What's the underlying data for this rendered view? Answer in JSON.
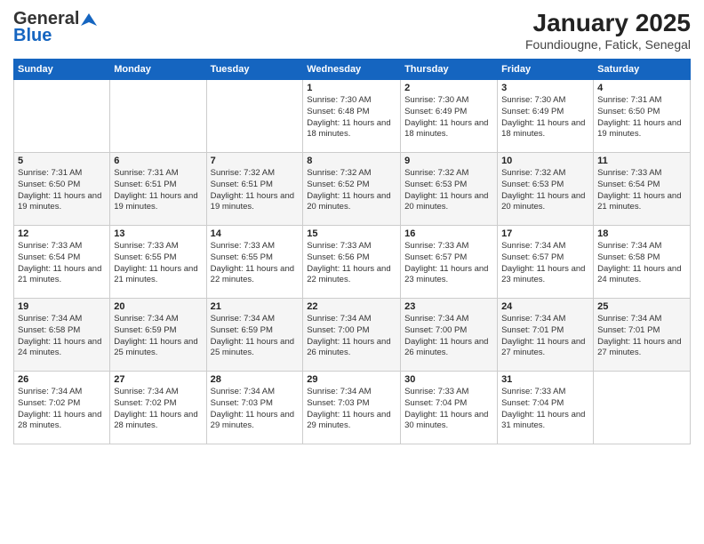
{
  "header": {
    "logo_general": "General",
    "logo_blue": "Blue",
    "title": "January 2025",
    "subtitle": "Foundiougne, Fatick, Senegal"
  },
  "weekdays": [
    "Sunday",
    "Monday",
    "Tuesday",
    "Wednesday",
    "Thursday",
    "Friday",
    "Saturday"
  ],
  "weeks": [
    [
      {
        "day": "",
        "sunrise": "",
        "sunset": "",
        "daylight": ""
      },
      {
        "day": "",
        "sunrise": "",
        "sunset": "",
        "daylight": ""
      },
      {
        "day": "",
        "sunrise": "",
        "sunset": "",
        "daylight": ""
      },
      {
        "day": "1",
        "sunrise": "Sunrise: 7:30 AM",
        "sunset": "Sunset: 6:48 PM",
        "daylight": "Daylight: 11 hours and 18 minutes."
      },
      {
        "day": "2",
        "sunrise": "Sunrise: 7:30 AM",
        "sunset": "Sunset: 6:49 PM",
        "daylight": "Daylight: 11 hours and 18 minutes."
      },
      {
        "day": "3",
        "sunrise": "Sunrise: 7:30 AM",
        "sunset": "Sunset: 6:49 PM",
        "daylight": "Daylight: 11 hours and 18 minutes."
      },
      {
        "day": "4",
        "sunrise": "Sunrise: 7:31 AM",
        "sunset": "Sunset: 6:50 PM",
        "daylight": "Daylight: 11 hours and 19 minutes."
      }
    ],
    [
      {
        "day": "5",
        "sunrise": "Sunrise: 7:31 AM",
        "sunset": "Sunset: 6:50 PM",
        "daylight": "Daylight: 11 hours and 19 minutes."
      },
      {
        "day": "6",
        "sunrise": "Sunrise: 7:31 AM",
        "sunset": "Sunset: 6:51 PM",
        "daylight": "Daylight: 11 hours and 19 minutes."
      },
      {
        "day": "7",
        "sunrise": "Sunrise: 7:32 AM",
        "sunset": "Sunset: 6:51 PM",
        "daylight": "Daylight: 11 hours and 19 minutes."
      },
      {
        "day": "8",
        "sunrise": "Sunrise: 7:32 AM",
        "sunset": "Sunset: 6:52 PM",
        "daylight": "Daylight: 11 hours and 20 minutes."
      },
      {
        "day": "9",
        "sunrise": "Sunrise: 7:32 AM",
        "sunset": "Sunset: 6:53 PM",
        "daylight": "Daylight: 11 hours and 20 minutes."
      },
      {
        "day": "10",
        "sunrise": "Sunrise: 7:32 AM",
        "sunset": "Sunset: 6:53 PM",
        "daylight": "Daylight: 11 hours and 20 minutes."
      },
      {
        "day": "11",
        "sunrise": "Sunrise: 7:33 AM",
        "sunset": "Sunset: 6:54 PM",
        "daylight": "Daylight: 11 hours and 21 minutes."
      }
    ],
    [
      {
        "day": "12",
        "sunrise": "Sunrise: 7:33 AM",
        "sunset": "Sunset: 6:54 PM",
        "daylight": "Daylight: 11 hours and 21 minutes."
      },
      {
        "day": "13",
        "sunrise": "Sunrise: 7:33 AM",
        "sunset": "Sunset: 6:55 PM",
        "daylight": "Daylight: 11 hours and 21 minutes."
      },
      {
        "day": "14",
        "sunrise": "Sunrise: 7:33 AM",
        "sunset": "Sunset: 6:55 PM",
        "daylight": "Daylight: 11 hours and 22 minutes."
      },
      {
        "day": "15",
        "sunrise": "Sunrise: 7:33 AM",
        "sunset": "Sunset: 6:56 PM",
        "daylight": "Daylight: 11 hours and 22 minutes."
      },
      {
        "day": "16",
        "sunrise": "Sunrise: 7:33 AM",
        "sunset": "Sunset: 6:57 PM",
        "daylight": "Daylight: 11 hours and 23 minutes."
      },
      {
        "day": "17",
        "sunrise": "Sunrise: 7:34 AM",
        "sunset": "Sunset: 6:57 PM",
        "daylight": "Daylight: 11 hours and 23 minutes."
      },
      {
        "day": "18",
        "sunrise": "Sunrise: 7:34 AM",
        "sunset": "Sunset: 6:58 PM",
        "daylight": "Daylight: 11 hours and 24 minutes."
      }
    ],
    [
      {
        "day": "19",
        "sunrise": "Sunrise: 7:34 AM",
        "sunset": "Sunset: 6:58 PM",
        "daylight": "Daylight: 11 hours and 24 minutes."
      },
      {
        "day": "20",
        "sunrise": "Sunrise: 7:34 AM",
        "sunset": "Sunset: 6:59 PM",
        "daylight": "Daylight: 11 hours and 25 minutes."
      },
      {
        "day": "21",
        "sunrise": "Sunrise: 7:34 AM",
        "sunset": "Sunset: 6:59 PM",
        "daylight": "Daylight: 11 hours and 25 minutes."
      },
      {
        "day": "22",
        "sunrise": "Sunrise: 7:34 AM",
        "sunset": "Sunset: 7:00 PM",
        "daylight": "Daylight: 11 hours and 26 minutes."
      },
      {
        "day": "23",
        "sunrise": "Sunrise: 7:34 AM",
        "sunset": "Sunset: 7:00 PM",
        "daylight": "Daylight: 11 hours and 26 minutes."
      },
      {
        "day": "24",
        "sunrise": "Sunrise: 7:34 AM",
        "sunset": "Sunset: 7:01 PM",
        "daylight": "Daylight: 11 hours and 27 minutes."
      },
      {
        "day": "25",
        "sunrise": "Sunrise: 7:34 AM",
        "sunset": "Sunset: 7:01 PM",
        "daylight": "Daylight: 11 hours and 27 minutes."
      }
    ],
    [
      {
        "day": "26",
        "sunrise": "Sunrise: 7:34 AM",
        "sunset": "Sunset: 7:02 PM",
        "daylight": "Daylight: 11 hours and 28 minutes."
      },
      {
        "day": "27",
        "sunrise": "Sunrise: 7:34 AM",
        "sunset": "Sunset: 7:02 PM",
        "daylight": "Daylight: 11 hours and 28 minutes."
      },
      {
        "day": "28",
        "sunrise": "Sunrise: 7:34 AM",
        "sunset": "Sunset: 7:03 PM",
        "daylight": "Daylight: 11 hours and 29 minutes."
      },
      {
        "day": "29",
        "sunrise": "Sunrise: 7:34 AM",
        "sunset": "Sunset: 7:03 PM",
        "daylight": "Daylight: 11 hours and 29 minutes."
      },
      {
        "day": "30",
        "sunrise": "Sunrise: 7:33 AM",
        "sunset": "Sunset: 7:04 PM",
        "daylight": "Daylight: 11 hours and 30 minutes."
      },
      {
        "day": "31",
        "sunrise": "Sunrise: 7:33 AM",
        "sunset": "Sunset: 7:04 PM",
        "daylight": "Daylight: 11 hours and 31 minutes."
      },
      {
        "day": "",
        "sunrise": "",
        "sunset": "",
        "daylight": ""
      }
    ]
  ]
}
